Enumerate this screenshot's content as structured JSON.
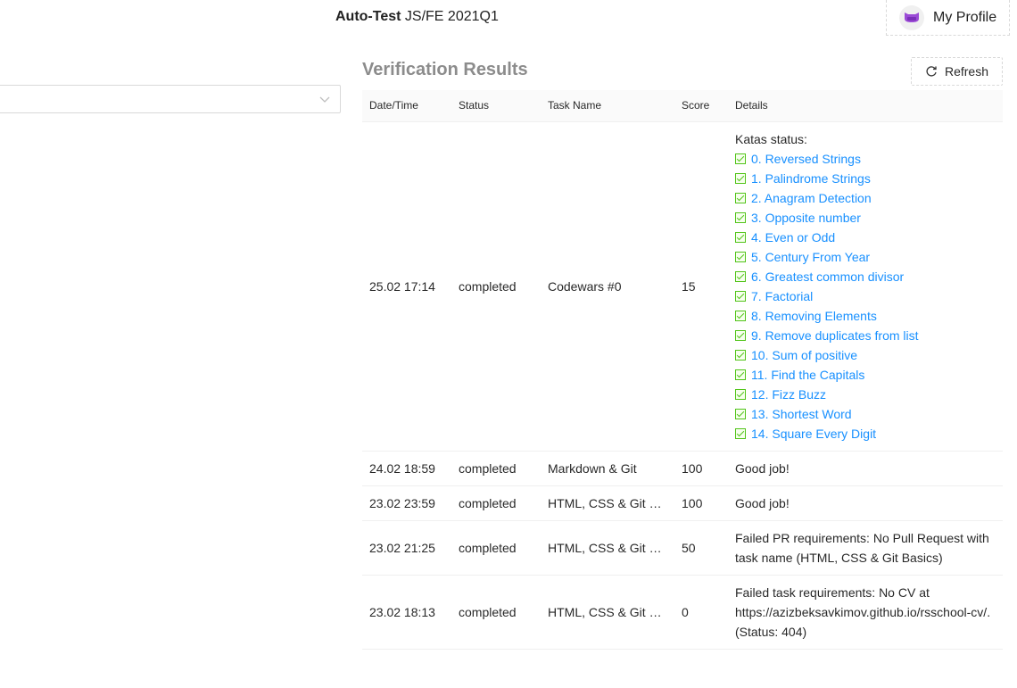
{
  "header": {
    "title_bold": "Auto-Test",
    "title_rest": " JS/FE 2021Q1",
    "profile_label": "My Profile",
    "avatar_icon": "github-octocat-avatar"
  },
  "course_select": {
    "value": "",
    "icon": "chevron-down-icon"
  },
  "results": {
    "title": "Verification Results",
    "refresh_label": "Refresh",
    "columns": [
      "Date/Time",
      "Status",
      "Task Name",
      "Score",
      "Details"
    ],
    "rows": [
      {
        "datetime": "25.02 17:14",
        "status": "completed",
        "task": "Codewars #0",
        "score": "15",
        "details_header": "Katas status:",
        "katas": [
          "0. Reversed Strings",
          "1. Palindrome Strings",
          "2. Anagram Detection",
          "3. Opposite number",
          "4. Even or Odd",
          "5. Century From Year",
          "6. Greatest common divisor",
          "7. Factorial",
          "8. Removing Elements",
          "9. Remove duplicates from list",
          "10. Sum of positive",
          "11. Find the Capitals",
          "12. Fizz Buzz",
          "13. Shortest Word",
          "14. Square Every Digit"
        ]
      },
      {
        "datetime": "24.02 18:59",
        "status": "completed",
        "task": "Markdown & Git",
        "score": "100",
        "details": "Good job!"
      },
      {
        "datetime": "23.02 23:59",
        "status": "completed",
        "task": "HTML, CSS & Git Basics",
        "score": "100",
        "details": "Good job!"
      },
      {
        "datetime": "23.02 21:25",
        "status": "completed",
        "task": "HTML, CSS & Git Basics",
        "score": "50",
        "details": "Failed PR requirements: No Pull Request with task name (HTML, CSS & Git Basics)"
      },
      {
        "datetime": "23.02 18:13",
        "status": "completed",
        "task": "HTML, CSS & Git Basics",
        "score": "0",
        "details": "Failed task requirements: No CV at https://azizbeksavkimov.github.io/rsschool-cv/. (Status: 404)"
      }
    ]
  },
  "colors": {
    "link": "#1890ff",
    "check": "#52c41a",
    "section_title": "#8c8c8c"
  }
}
